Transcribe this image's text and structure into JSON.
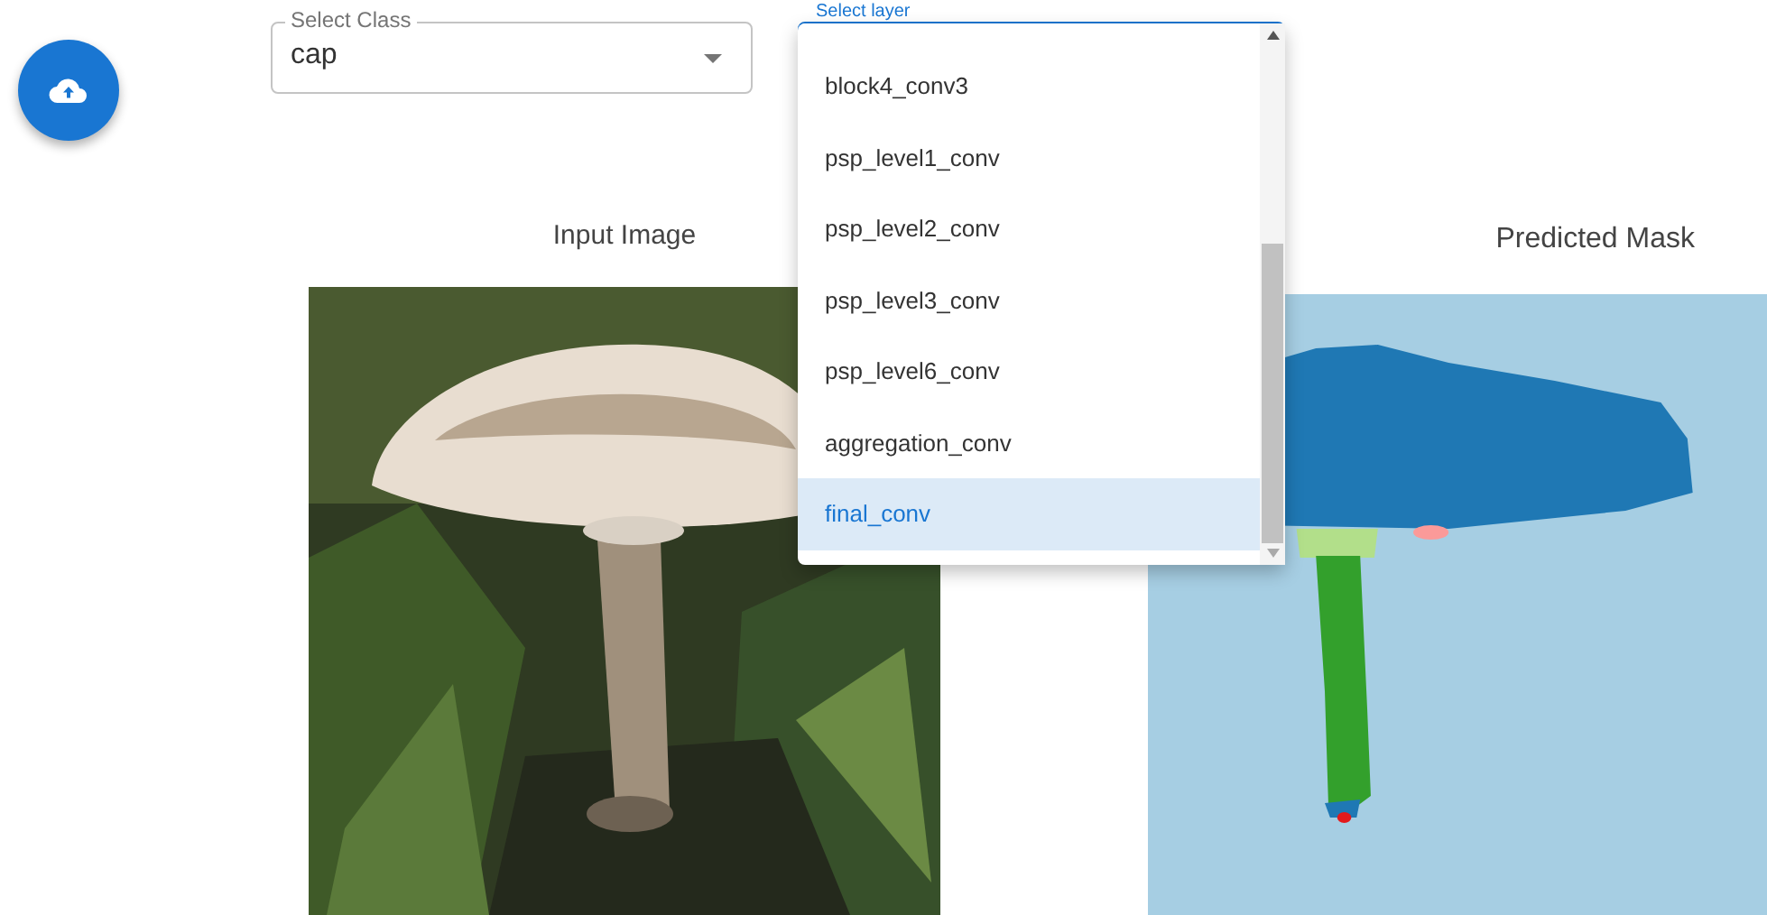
{
  "upload_button": {
    "kind": "fab"
  },
  "class_select": {
    "label": "Select Class",
    "value": "cap"
  },
  "layer_select": {
    "label": "Select layer",
    "expanded": true
  },
  "layer_menu": [
    {
      "label": "block4_conv3",
      "selected": false
    },
    {
      "label": "psp_level1_conv",
      "selected": false
    },
    {
      "label": "psp_level2_conv",
      "selected": false
    },
    {
      "label": "psp_level3_conv",
      "selected": false
    },
    {
      "label": "psp_level6_conv",
      "selected": false
    },
    {
      "label": "aggregation_conv",
      "selected": false
    },
    {
      "label": "final_conv",
      "selected": true
    }
  ],
  "panels": [
    {
      "title": "Input Image"
    },
    {
      "title": "Predicted Mask",
      "kind": "mask"
    }
  ]
}
